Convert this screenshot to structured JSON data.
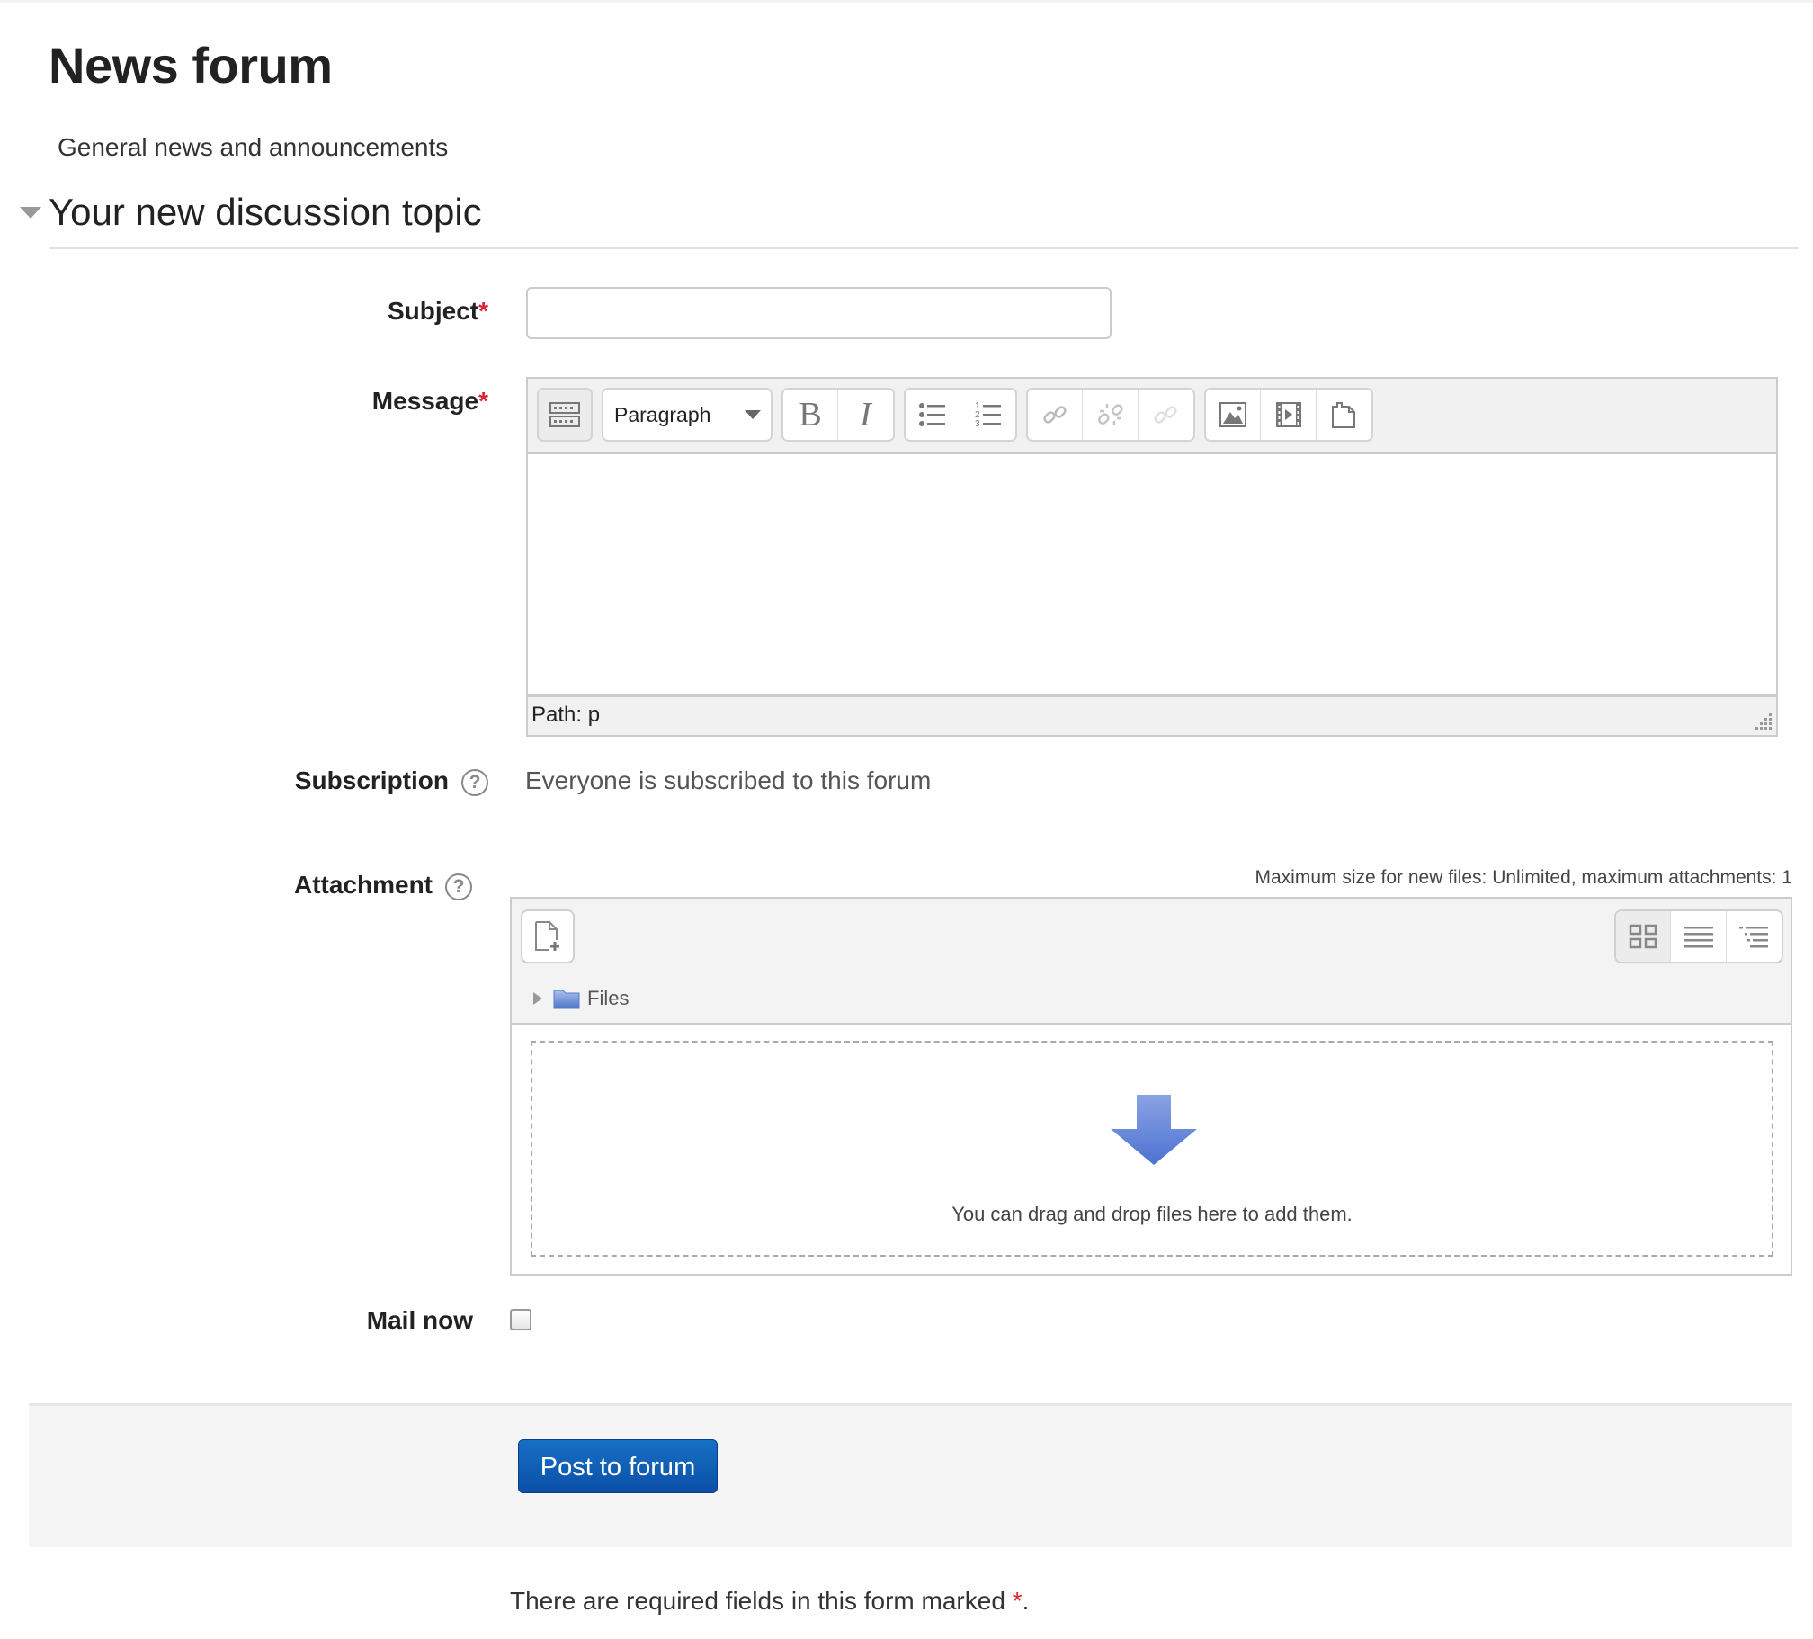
{
  "page": {
    "title": "News forum",
    "description": "General news and announcements"
  },
  "section": {
    "legend": "Your new discussion topic",
    "expanded": true
  },
  "form": {
    "subject": {
      "label": "Subject",
      "required_marker": "*",
      "value": "",
      "placeholder": ""
    },
    "message": {
      "label": "Message",
      "required_marker": "*",
      "value": "",
      "toolbar": {
        "toggle_icon": "toolbar-toggle-icon",
        "format_select": {
          "selected": "Paragraph"
        },
        "buttons": [
          {
            "name": "bold",
            "glyph": "B",
            "icon": "bold-icon"
          },
          {
            "name": "italic",
            "glyph": "I",
            "icon": "italic-icon"
          },
          {
            "name": "unordered-list",
            "icon": "bullet-list-icon"
          },
          {
            "name": "ordered-list",
            "icon": "numbered-list-icon"
          },
          {
            "name": "link",
            "icon": "link-icon"
          },
          {
            "name": "unlink",
            "icon": "unlink-icon"
          },
          {
            "name": "anchor",
            "icon": "anchor-icon"
          },
          {
            "name": "image",
            "icon": "image-icon"
          },
          {
            "name": "media",
            "icon": "media-icon"
          },
          {
            "name": "manage-files",
            "icon": "manage-files-icon"
          }
        ]
      },
      "path_label": "Path:",
      "path_value": "p"
    },
    "subscription": {
      "label": "Subscription",
      "help_glyph": "?",
      "value": "Everyone is subscribed to this forum"
    },
    "attachment": {
      "label": "Attachment",
      "help_glyph": "?",
      "limits": "Maximum size for new files: Unlimited, maximum attachments: 1",
      "folder_label": "Files",
      "drop_text": "You can drag and drop files here to add them.",
      "view_modes": [
        "icons",
        "list",
        "tree"
      ],
      "active_view": "icons"
    },
    "mail_now": {
      "label": "Mail now",
      "checked": false
    },
    "submit_label": "Post to forum",
    "required_note_prefix": "There are required fields in this form marked ",
    "required_note_marker": "*",
    "required_note_suffix": "."
  },
  "colors": {
    "required": "#e0212e",
    "primary_button": "#0b4fa8",
    "drop_arrow": "#5b7fd6",
    "folder": "#6d8fd8"
  }
}
